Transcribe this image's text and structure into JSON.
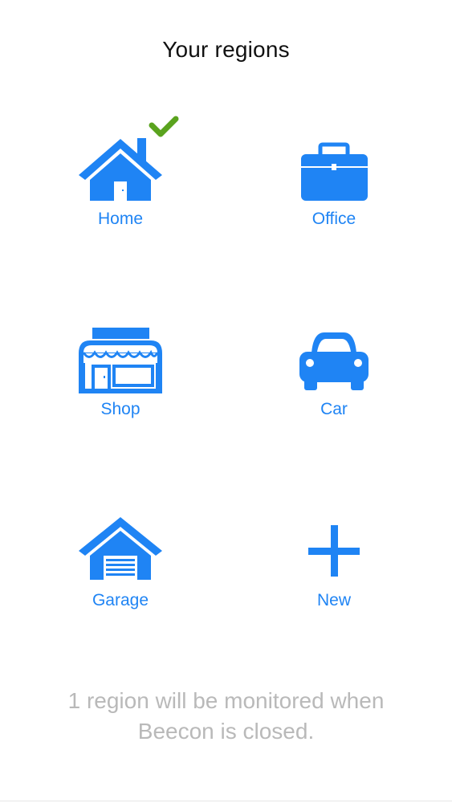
{
  "header": {
    "title": "Your regions"
  },
  "colors": {
    "accent": "#1f84f4",
    "check": "#5aa31e",
    "footer_text": "#b9b9b9"
  },
  "regions": [
    {
      "label": "Home",
      "icon": "house-icon",
      "monitored": true
    },
    {
      "label": "Office",
      "icon": "briefcase-icon",
      "monitored": false
    },
    {
      "label": "Shop",
      "icon": "storefront-icon",
      "monitored": false
    },
    {
      "label": "Car",
      "icon": "car-icon",
      "monitored": false
    },
    {
      "label": "Garage",
      "icon": "garage-icon",
      "monitored": false
    },
    {
      "label": "New",
      "icon": "plus-icon",
      "monitored": false
    }
  ],
  "footer": {
    "line1": "1 region will be monitored when",
    "line2": "Beecon is closed."
  }
}
